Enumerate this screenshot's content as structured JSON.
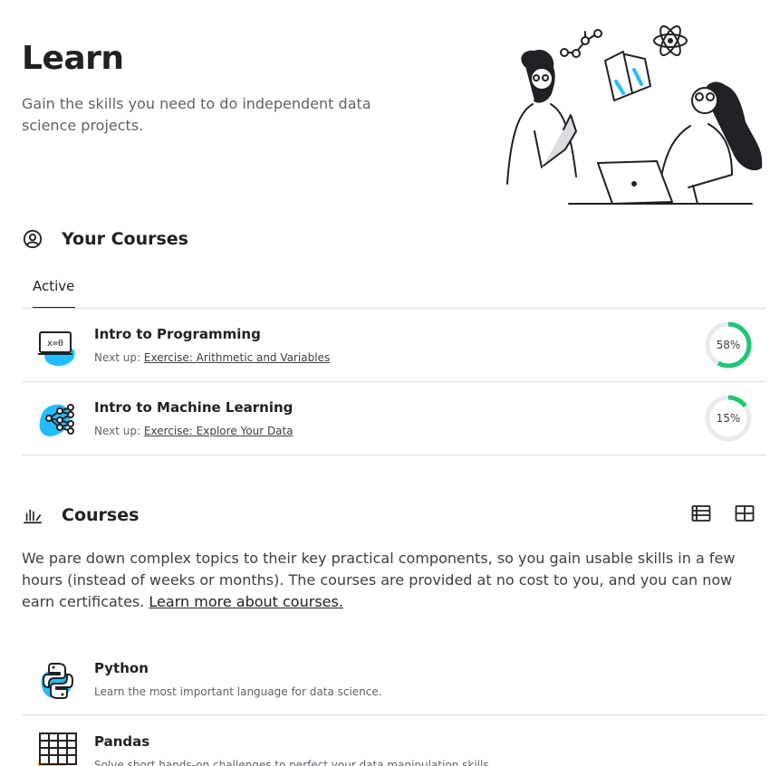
{
  "header": {
    "title": "Learn",
    "subtitle": "Gain the skills you need to do independent data science projects."
  },
  "your_courses": {
    "title": "Your Courses",
    "icon": "user-circle-icon",
    "tabs": [
      {
        "label": "Active",
        "selected": true
      }
    ],
    "items": [
      {
        "name": "Intro to Programming",
        "next_label": "Next up:",
        "next_link": "Exercise: Arithmetic and Variables",
        "progress_pct": 58,
        "progress_text": "58%",
        "icon": "laptop-code-icon"
      },
      {
        "name": "Intro to Machine Learning",
        "next_label": "Next up:",
        "next_link": "Exercise: Explore Your Data",
        "progress_pct": 15,
        "progress_text": "15%",
        "icon": "network-graph-icon"
      }
    ]
  },
  "courses": {
    "title": "Courses",
    "icon": "bar-chart-icon",
    "view_icons": [
      "list-view-icon",
      "grid-view-icon"
    ],
    "description": "We pare down complex topics to their key practical components, so you gain usable skills in a few hours (instead of weeks or months). The courses are provided at no cost to you, and you can now earn certificates.",
    "learn_more_link": "Learn more about courses.",
    "items": [
      {
        "name": "Python",
        "desc": "Learn the most important language for data science.",
        "icon": "python-logo-icon"
      },
      {
        "name": "Pandas",
        "desc": "Solve short hands-on challenges to perfect your data manipulation skills.",
        "icon": "table-grid-icon"
      }
    ]
  },
  "colors": {
    "progress_green": "#1ec776",
    "progress_track": "#e8eaed",
    "accent_blue": "#20beff",
    "accent_yellow": "#ffd83d",
    "text_primary": "#202124",
    "text_secondary": "#5f6368"
  }
}
